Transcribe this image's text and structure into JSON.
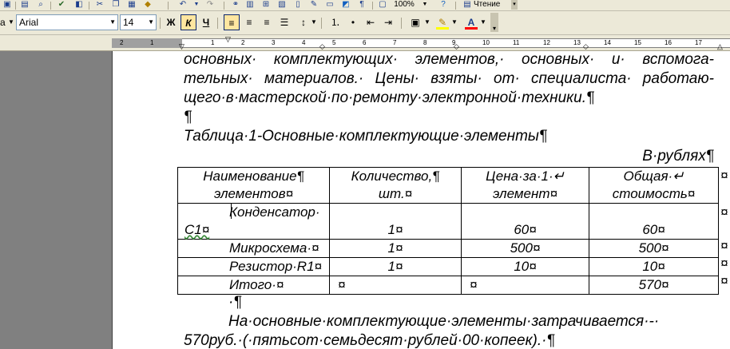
{
  "toolbar1": {
    "zoom": "100%",
    "reading_label": "Чтение"
  },
  "toolbar2": {
    "style_fragment": "а",
    "font_name": "Arial",
    "font_size": "14",
    "bold_label": "Ж",
    "italic_label": "К",
    "underline_label": "Ч",
    "font_color_label": "A"
  },
  "ruler": {
    "numbers": [
      "2",
      "1",
      "1",
      "2",
      "3",
      "4",
      "5",
      "6",
      "7",
      "8",
      "9",
      "10",
      "11",
      "12",
      "13",
      "14",
      "15",
      "16",
      "17"
    ]
  },
  "document": {
    "line1": "основных· комплектующих· элементов,· основных· и· вспомога-",
    "line2": "тельных· материалов.· Цены· взяты· от· специалиста· работаю-",
    "line3": "щего·в·мастерской·по·ремонту·электронной·техники.¶",
    "line4": "¶",
    "table_caption": "Таблица·1-Основные·комплектующие·элементы¶",
    "currency_note": "В·рублях¶",
    "after_table": "·¶",
    "para1": "На·основные·комплектующие·элементы·затрачивается·-·",
    "para2": "570руб.·(·пятьсот·семьдесят·рублей·00·копеек).·¶"
  },
  "table": {
    "headers": [
      {
        "l1": "Наименование¶",
        "l2": "элементов¤"
      },
      {
        "l1": "Количество,¶",
        "l2": "шт.¤"
      },
      {
        "l1": "Цена·за·1·↵",
        "l2": "элемент¤"
      },
      {
        "l1": "Общая·↵",
        "l2": "стоимость¤"
      }
    ],
    "row1": {
      "name1": "Конденсатор·",
      "name2": "С1¤",
      "qty": "1¤",
      "price": "60¤",
      "total": "60¤"
    },
    "row2": {
      "name": "Микросхема·¤",
      "qty": "1¤",
      "price": "500¤",
      "total": "500¤"
    },
    "row3": {
      "name": "Резистор·R1¤",
      "qty": "1¤",
      "price": "10¤",
      "total": "10¤"
    },
    "row4": {
      "name": "Итого·¤",
      "qty": "¤",
      "price": "¤",
      "total": "570¤"
    },
    "end_mark": "¤"
  }
}
